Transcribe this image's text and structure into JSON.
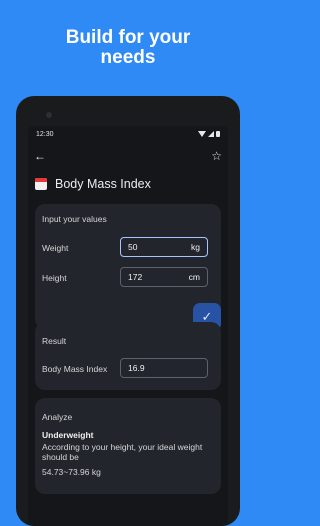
{
  "headline": {
    "line1": "Build for your",
    "line2": "needs"
  },
  "status": {
    "time": "12:30"
  },
  "page": {
    "title": "Body Mass Index"
  },
  "inputs": {
    "header": "Input your values",
    "weight_label": "Weight",
    "weight_value": "50",
    "weight_unit": "kg",
    "height_label": "Height",
    "height_value": "172",
    "height_unit": "cm"
  },
  "result": {
    "header": "Result",
    "bmi_label": "Body Mass Index",
    "bmi_value": "16.9"
  },
  "analyze": {
    "header": "Analyze",
    "classification": "Underweight",
    "text": "According to your height, your ideal weight should be",
    "range": "54.73~73.96 kg"
  },
  "icons": {
    "back": "arrow-left-icon",
    "favorite": "star-icon",
    "confirm": "check-icon",
    "calendar": "calendar-icon"
  }
}
